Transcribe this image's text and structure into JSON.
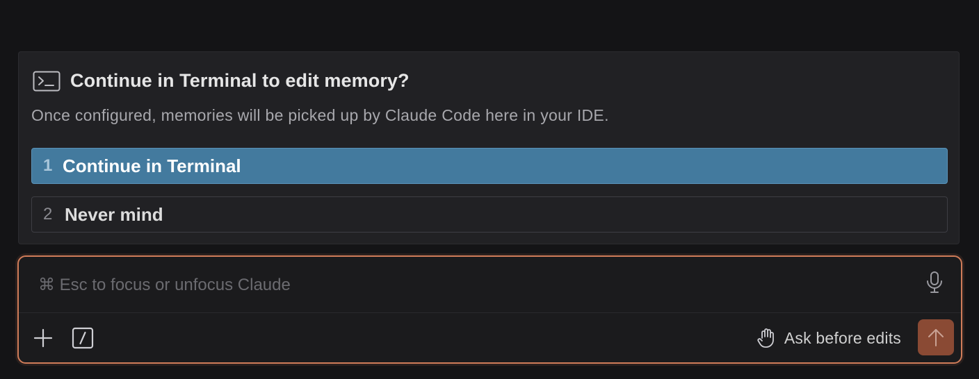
{
  "dialog": {
    "icon": "terminal-icon",
    "title": "Continue in Terminal to edit memory?",
    "subtitle": "Once configured, memories will be picked up by Claude Code here in your IDE.",
    "options": [
      {
        "number": "1",
        "label": "Continue in Terminal",
        "selected": true
      },
      {
        "number": "2",
        "label": "Never mind",
        "selected": false
      }
    ]
  },
  "composer": {
    "placeholder": "⌘ Esc to focus or unfocus Claude",
    "value": "",
    "mic_icon": "microphone-icon",
    "attach_icon": "plus-icon",
    "commands_icon": "slash-command-icon",
    "mode_icon": "hand-icon",
    "mode_label": "Ask before edits",
    "send_icon": "arrow-up-icon"
  },
  "colors": {
    "background": "#141416",
    "dialog_bg": "#212124",
    "selected_option": "#437a9e",
    "composer_border": "#d07c59",
    "send_button": "#8a4a34"
  }
}
